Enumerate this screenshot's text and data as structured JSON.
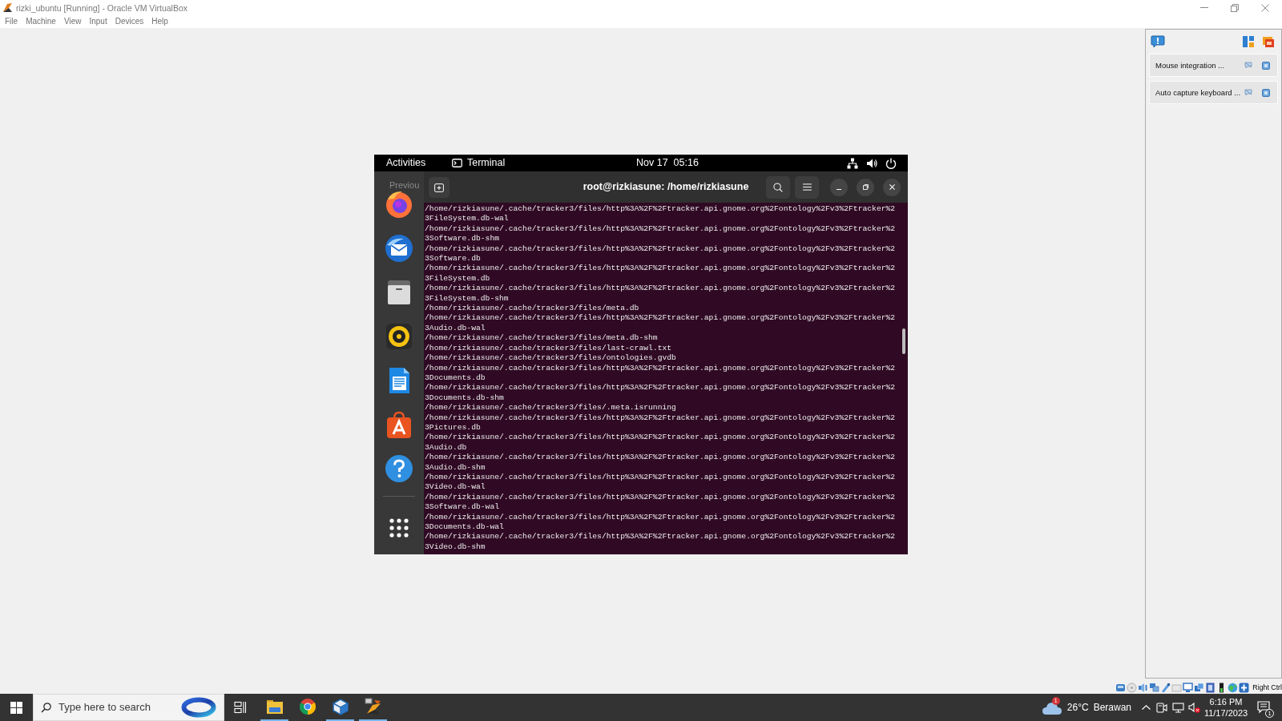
{
  "window": {
    "title": "rizki_ubuntu [Running] - Oracle VM VirtualBox"
  },
  "menu": [
    "File",
    "Machine",
    "View",
    "Input",
    "Devices",
    "Help"
  ],
  "guest_top_bar": {
    "activities": "Activities",
    "app": "Terminal",
    "clock": "Nov 17  05:16"
  },
  "background_window": {
    "text": "Previou"
  },
  "terminal": {
    "title": "root@rizkiasune: /home/rizkiasune",
    "lines": [
      "/home/rizkiasune/.cache/tracker3/files/http%3A%2F%2Ftracker.api.gnome.org%2Fontology%2Fv3%2Ftracker%2",
      "3FileSystem.db-wal",
      "/home/rizkiasune/.cache/tracker3/files/http%3A%2F%2Ftracker.api.gnome.org%2Fontology%2Fv3%2Ftracker%2",
      "3Software.db-shm",
      "/home/rizkiasune/.cache/tracker3/files/http%3A%2F%2Ftracker.api.gnome.org%2Fontology%2Fv3%2Ftracker%2",
      "3Software.db",
      "/home/rizkiasune/.cache/tracker3/files/http%3A%2F%2Ftracker.api.gnome.org%2Fontology%2Fv3%2Ftracker%2",
      "3FileSystem.db",
      "/home/rizkiasune/.cache/tracker3/files/http%3A%2F%2Ftracker.api.gnome.org%2Fontology%2Fv3%2Ftracker%2",
      "3FileSystem.db-shm",
      "/home/rizkiasune/.cache/tracker3/files/meta.db",
      "/home/rizkiasune/.cache/tracker3/files/http%3A%2F%2Ftracker.api.gnome.org%2Fontology%2Fv3%2Ftracker%2",
      "3Audio.db-wal",
      "/home/rizkiasune/.cache/tracker3/files/meta.db-shm",
      "/home/rizkiasune/.cache/tracker3/files/last-crawl.txt",
      "/home/rizkiasune/.cache/tracker3/files/ontologies.gvdb",
      "/home/rizkiasune/.cache/tracker3/files/http%3A%2F%2Ftracker.api.gnome.org%2Fontology%2Fv3%2Ftracker%2",
      "3Documents.db",
      "/home/rizkiasune/.cache/tracker3/files/http%3A%2F%2Ftracker.api.gnome.org%2Fontology%2Fv3%2Ftracker%2",
      "3Documents.db-shm",
      "/home/rizkiasune/.cache/tracker3/files/.meta.isrunning",
      "/home/rizkiasune/.cache/tracker3/files/http%3A%2F%2Ftracker.api.gnome.org%2Fontology%2Fv3%2Ftracker%2",
      "3Pictures.db",
      "/home/rizkiasune/.cache/tracker3/files/http%3A%2F%2Ftracker.api.gnome.org%2Fontology%2Fv3%2Ftracker%2",
      "3Audio.db",
      "/home/rizkiasune/.cache/tracker3/files/http%3A%2F%2Ftracker.api.gnome.org%2Fontology%2Fv3%2Ftracker%2",
      "3Audio.db-shm",
      "/home/rizkiasune/.cache/tracker3/files/http%3A%2F%2Ftracker.api.gnome.org%2Fontology%2Fv3%2Ftracker%2",
      "3Video.db-wal",
      "/home/rizkiasune/.cache/tracker3/files/http%3A%2F%2Ftracker.api.gnome.org%2Fontology%2Fv3%2Ftracker%2",
      "3Software.db-wal",
      "/home/rizkiasune/.cache/tracker3/files/http%3A%2F%2Ftracker.api.gnome.org%2Fontology%2Fv3%2Ftracker%2",
      "3Documents.db-wal",
      "/home/rizkiasune/.cache/tracker3/files/http%3A%2F%2Ftracker.api.gnome.org%2Fontology%2Fv3%2Ftracker%2",
      "3Video.db-shm"
    ]
  },
  "notifications": [
    {
      "text": "Mouse integration ..."
    },
    {
      "text": "Auto capture keyboard ..."
    }
  ],
  "status_bar": {
    "host_key": "Right Ctrl"
  },
  "taskbar": {
    "search": {
      "placeholder": "Type here to search"
    },
    "apps": [
      {
        "kind": "folder",
        "running": true
      },
      {
        "kind": "browser",
        "running": false
      },
      {
        "kind": "cube",
        "running": true
      },
      {
        "kind": "machine",
        "running": true
      }
    ],
    "weather": {
      "badge": "1",
      "temperature": "26°C",
      "condition": "Berawan"
    },
    "volume_muted": true,
    "clock": {
      "time": "6:16 PM",
      "date": "11/17/2023"
    },
    "notification_count": "1"
  }
}
